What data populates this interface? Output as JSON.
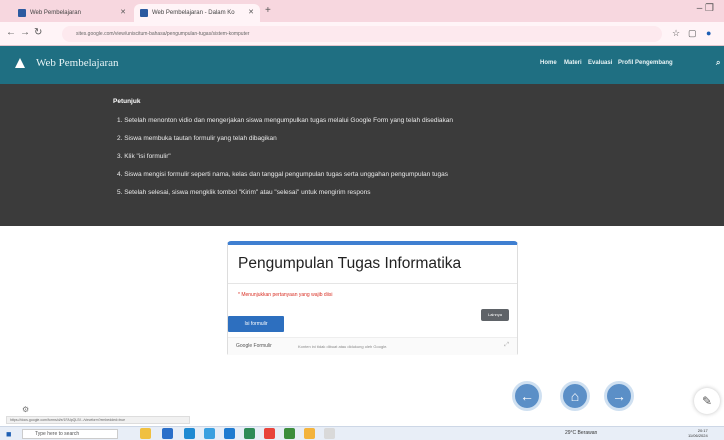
{
  "browser": {
    "tabs": [
      {
        "label": "Web Pembelajaran"
      },
      {
        "label": "Web Pembelajaran - Dalam Ko"
      }
    ],
    "new_tab": "+",
    "window_controls": "–   ❐",
    "url": "sites.google.com/view/uniscitum-bahasa/pengumpulan-tugas/sistem-komputer"
  },
  "site": {
    "title": "Web Pembelajaran",
    "nav": [
      "Home",
      "Materi",
      "Evaluasi",
      "Profil Pengembang"
    ]
  },
  "instructions": {
    "heading": "Petunjuk",
    "steps": [
      "1. Setelah menonton vidio dan mengerjakan siswa mengumpulkan tugas melalui Google Form yang telah disediakan",
      "2. Siswa membuka tautan formulir yang telah dibagikan",
      "3. Klik \"isi formulir\"",
      "4. Siswa mengisi formulir seperti nama, kelas dan tanggal pengumpulan tugas serta unggahan pengumpulan tugas",
      "5. Setelah selesai, siswa mengklik tombol \"Kirim\" atau \"selesai\" untuk mengirim respons"
    ]
  },
  "form": {
    "title": "Pengumpulan Tugas Informatika",
    "required_note": "* Menunjukkan pertanyaan yang wajib diisi",
    "fill_button": "Isi formulir",
    "more_button": "Lainnya",
    "footer_brand": "Google Formulir",
    "footer_note": "Konten ini tidak dibuat atau didukung oleh Google."
  },
  "status_url": "https://docs.google.com/forms/d/e/1FAIpQLSf.../viewform?embedded=true",
  "taskbar": {
    "search_placeholder": "Type here to search",
    "weather": "29°C Berawan",
    "clock_time": "20:17",
    "clock_date": "11/06/2024"
  },
  "colors": {
    "nav_bg": "#1f6f82",
    "panel_bg": "#3b3b3b",
    "form_accent": "#3f7fd1",
    "tab_bar": "#f7d7df"
  }
}
